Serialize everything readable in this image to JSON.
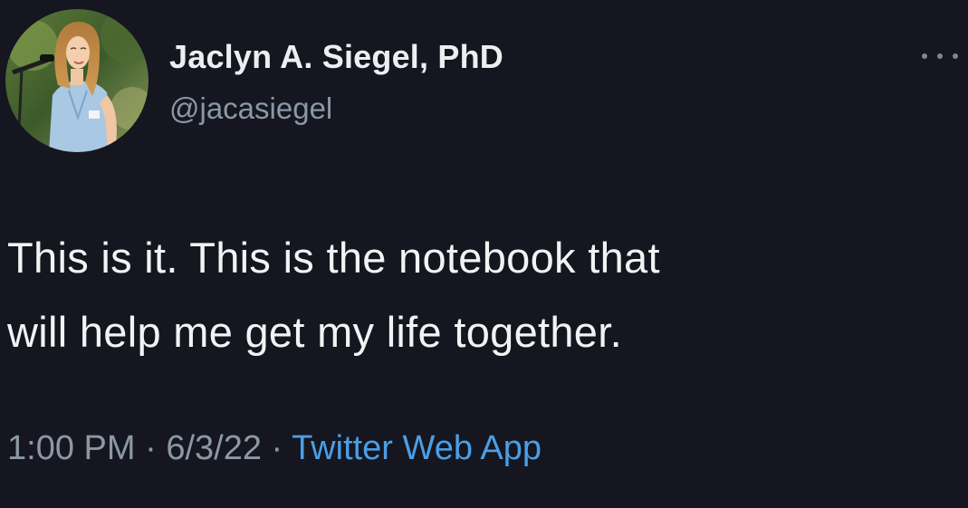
{
  "author": {
    "display_name": "Jaclyn A. Siegel, PhD",
    "handle": "@jacasiegel",
    "avatar_icon": "profile-photo"
  },
  "menu": {
    "icon": "more-options-icon"
  },
  "tweet": {
    "lines": [
      "This is it. This is the notebook that",
      "will help me get my life together."
    ]
  },
  "meta": {
    "time": "1:00 PM",
    "separator": "·",
    "date": "6/3/22",
    "source": "Twitter Web App"
  },
  "colors": {
    "background": "#15161f",
    "primary_text": "#f1f3f4",
    "secondary_text": "#8b98a5",
    "link": "#4b9ee6"
  }
}
